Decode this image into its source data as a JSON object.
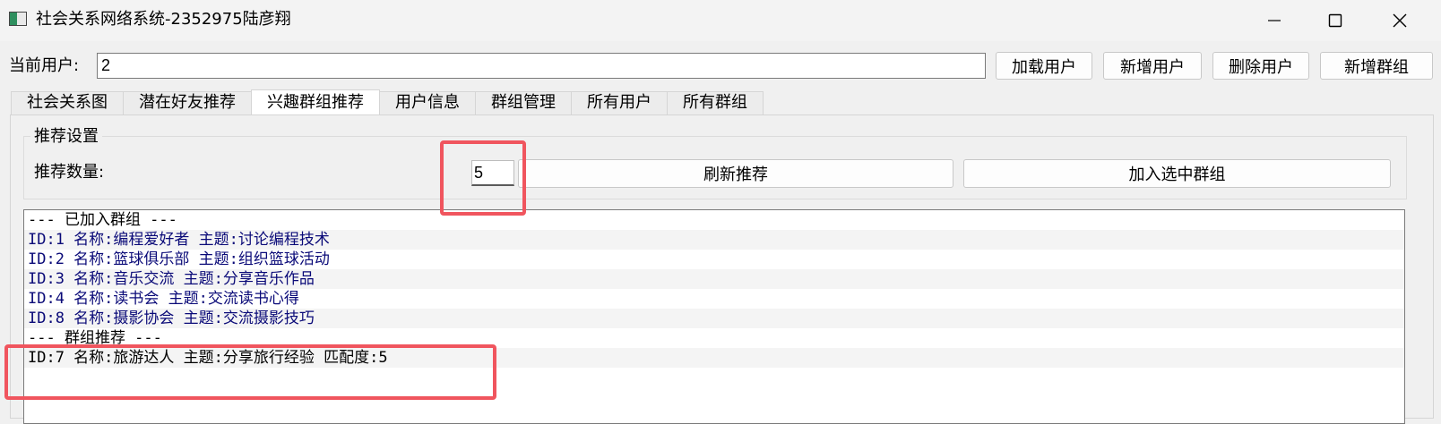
{
  "window": {
    "title": "社会关系网络系统-2352975陆彦翔"
  },
  "toolbar": {
    "current_user_label": "当前用户:",
    "current_user_value": "2",
    "load_user": "加载用户",
    "add_user": "新增用户",
    "delete_user": "删除用户",
    "add_group": "新增群组"
  },
  "tabs": [
    {
      "label": "社会关系图"
    },
    {
      "label": "潜在好友推荐"
    },
    {
      "label": "兴趣群组推荐",
      "active": true
    },
    {
      "label": "用户信息"
    },
    {
      "label": "群组管理"
    },
    {
      "label": "所有用户"
    },
    {
      "label": "所有群组"
    }
  ],
  "settings": {
    "title": "推荐设置",
    "count_label": "推荐数量:",
    "count_value": "5",
    "refresh_button": "刷新推荐",
    "join_button": "加入选中群组"
  },
  "list": {
    "lines": [
      "--- 已加入群组 ---",
      "ID:1 名称:编程爱好者 主题:讨论编程技术",
      "ID:2 名称:篮球俱乐部 主题:组织篮球活动",
      "ID:3 名称:音乐交流 主题:分享音乐作品",
      "ID:4 名称:读书会 主题:交流读书心得",
      "ID:8 名称:摄影协会 主题:交流摄影技巧",
      "--- 群组推荐 ---",
      "ID:7 名称:旅游达人 主题:分享旅行经验 匹配度:5"
    ]
  },
  "colors": {
    "highlight": "#f0555e",
    "list_item_text": "#0a0a78"
  }
}
